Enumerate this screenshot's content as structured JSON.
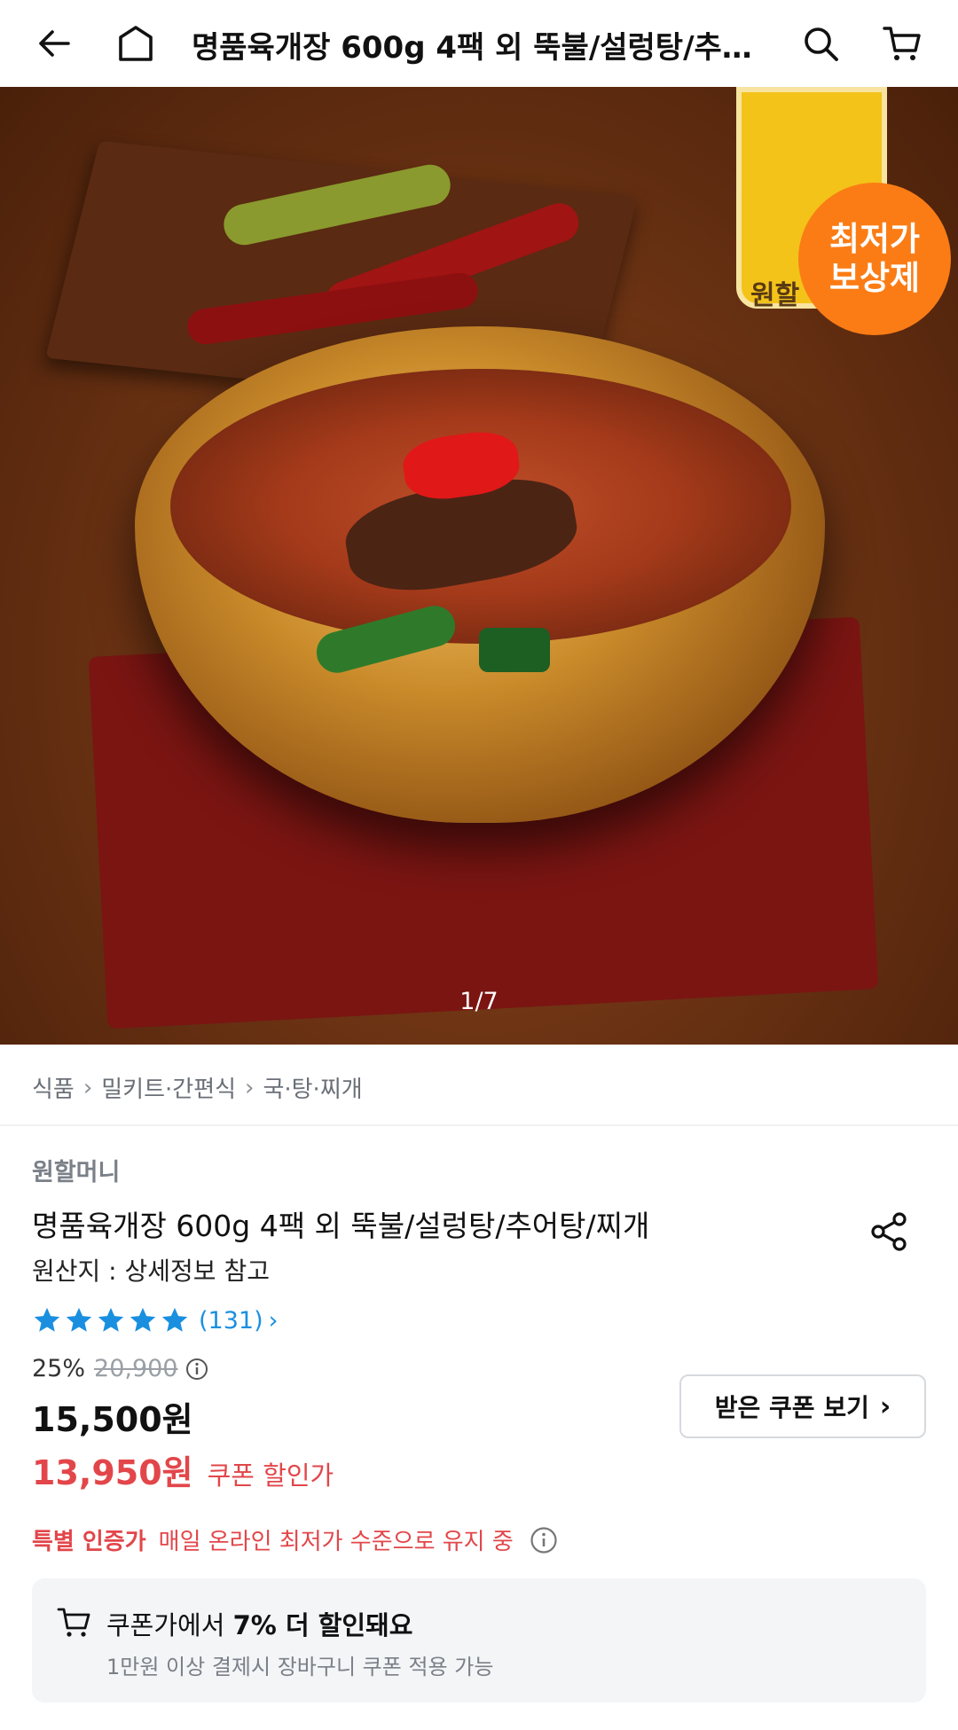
{
  "header": {
    "title": "명품육개장 600g 4팩 외 뚝불/설렁탕/추…",
    "icons": [
      "back-arrow-icon",
      "home-icon",
      "search-icon",
      "cart-icon"
    ]
  },
  "hero": {
    "badge_line1": "최저가",
    "badge_line2": "보상제",
    "package_text": "원할",
    "counter": "1/7"
  },
  "breadcrumb": {
    "items": [
      "식품",
      "밀키트·간편식",
      "국·탕·찌개"
    ]
  },
  "product": {
    "brand": "원할머니",
    "title": "명품육개장 600g 4팩 외 뚝불/설렁탕/추어탕/찌개",
    "origin": "원산지 : 상세정보 참고",
    "rating_count": "(131)",
    "rating_stars": 5,
    "discount_rate": "25%",
    "original_price": "20,900",
    "price": "15,500원",
    "coupon_price": "13,950원",
    "coupon_label": "쿠폰 할인가",
    "coupon_button": "받은 쿠폰 보기"
  },
  "special": {
    "tag": "특별 인증가",
    "desc": "매일 온라인 최저가 수준으로 유지 중"
  },
  "promo": {
    "main_prefix": "쿠폰가에서 ",
    "main_bold": "7% 더 할인돼요",
    "sub": "1만원 이상 결제시 장바구니 쿠폰 적용 가능"
  },
  "colors": {
    "accent_red": "#e2464a",
    "star_blue": "#1a8fe0",
    "badge_orange": "#fb7c15"
  }
}
